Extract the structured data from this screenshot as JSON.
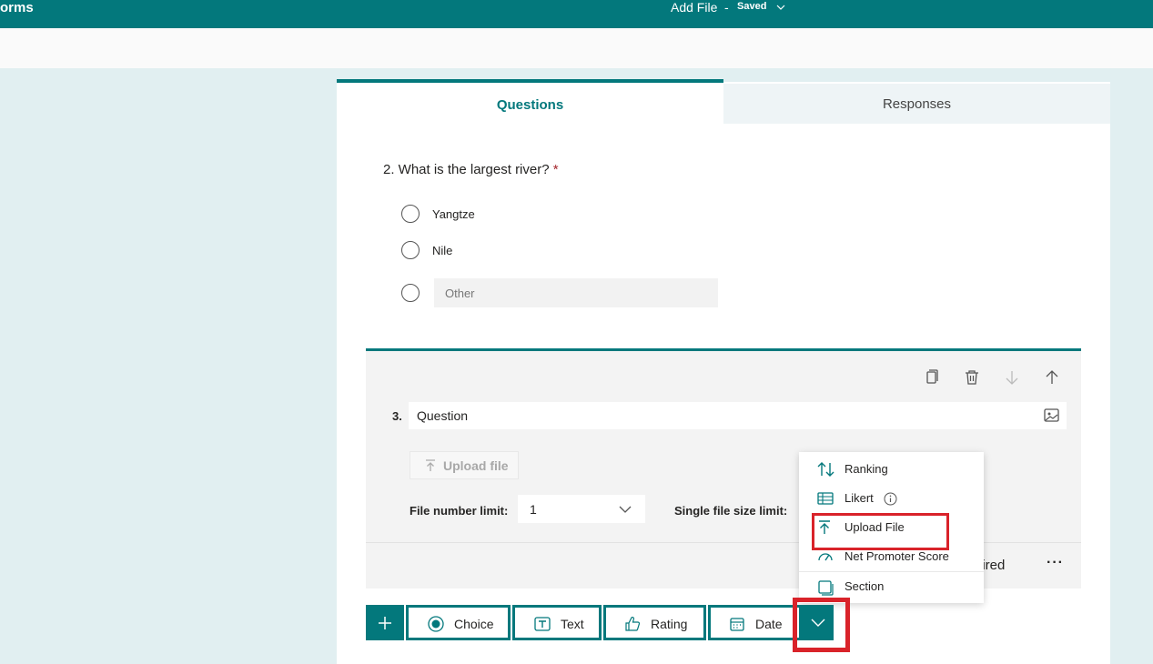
{
  "topbar": {
    "app_name": "orms",
    "doc_title": "Add File",
    "separator": "-",
    "save_status": "Saved",
    "bg_color": "#03787c"
  },
  "tabs": [
    {
      "label": "Questions",
      "selected": true
    },
    {
      "label": "Responses",
      "selected": false
    }
  ],
  "question2": {
    "number_and_text": "2. What is the largest river?",
    "required_mark": "*",
    "options": [
      "Yangtze",
      "Nile"
    ],
    "other_placeholder": "Other"
  },
  "question3": {
    "number": "3.",
    "text": "Question",
    "upload_button": "Upload file",
    "file_number_limit_label": "File number limit:",
    "file_number_limit_value": "1",
    "single_file_size_label": "Single file size limit:",
    "required_label": "uired",
    "more_label": "···",
    "toolbar_icons": [
      "copy-icon",
      "delete-icon",
      "move-down-icon",
      "move-up-icon"
    ]
  },
  "type_menu": {
    "items": [
      {
        "label": "Ranking",
        "icon": "ranking-icon"
      },
      {
        "label": "Likert",
        "icon": "likert-icon"
      },
      {
        "label": "Upload File",
        "icon": "upload-icon"
      },
      {
        "label": "Net Promoter Score",
        "icon": "nps-icon"
      },
      {
        "label": "Section",
        "icon": "section-icon"
      }
    ],
    "highlighted": "Upload File"
  },
  "add_toolbar": {
    "add_label": "+",
    "types": [
      "Choice",
      "Text",
      "Rating",
      "Date"
    ],
    "more_icon": "chevron-down-icon"
  },
  "colors": {
    "accent": "#03787c",
    "highlight": "#d9232a",
    "required": "#a4262c"
  }
}
